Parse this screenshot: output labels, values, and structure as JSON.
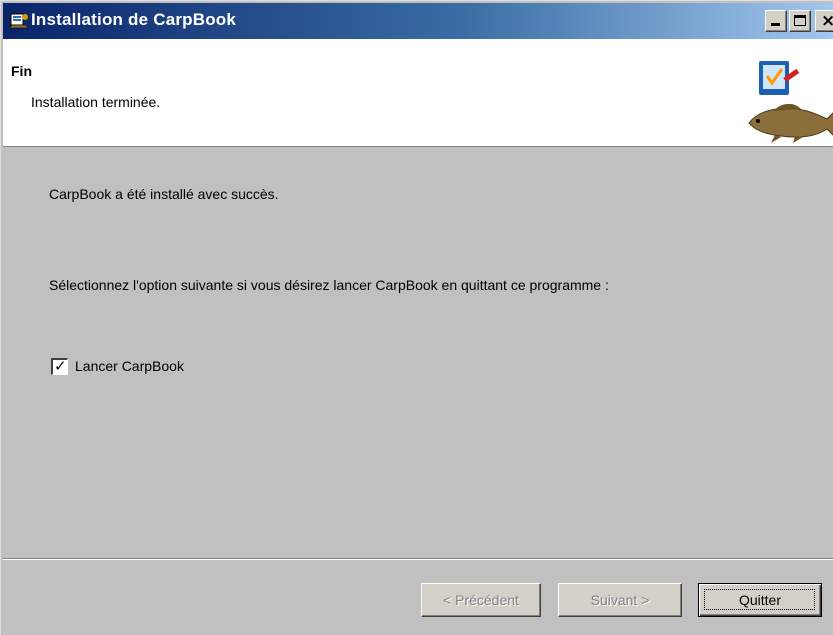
{
  "window": {
    "title": "Installation de CarpBook",
    "icon": "installer-icon",
    "controls": {
      "minimize": "minimize-icon",
      "maximize": "maximize-icon",
      "close": "close-icon"
    }
  },
  "header": {
    "title": "Fin",
    "subtitle": "Installation terminée.",
    "graphic": "checklist-and-carp-fish-graphic"
  },
  "content": {
    "success_message": "CarpBook a été installé avec succès.",
    "option_prompt": "Sélectionnez l'option suivante si vous désirez lancer CarpBook en quittant ce programme :",
    "launch_checkbox": {
      "label": "Lancer CarpBook",
      "checked": true
    }
  },
  "buttons": {
    "previous": {
      "label": "< Précédent",
      "enabled": false
    },
    "next": {
      "label": "Suivant >",
      "enabled": false
    },
    "quit": {
      "label": "Quitter",
      "enabled": true,
      "default": true
    }
  },
  "colors": {
    "title_gradient_start": "#0a246a",
    "title_gradient_end": "#a6caf0",
    "face": "#c0c0c0",
    "header_bg": "#ffffff"
  }
}
